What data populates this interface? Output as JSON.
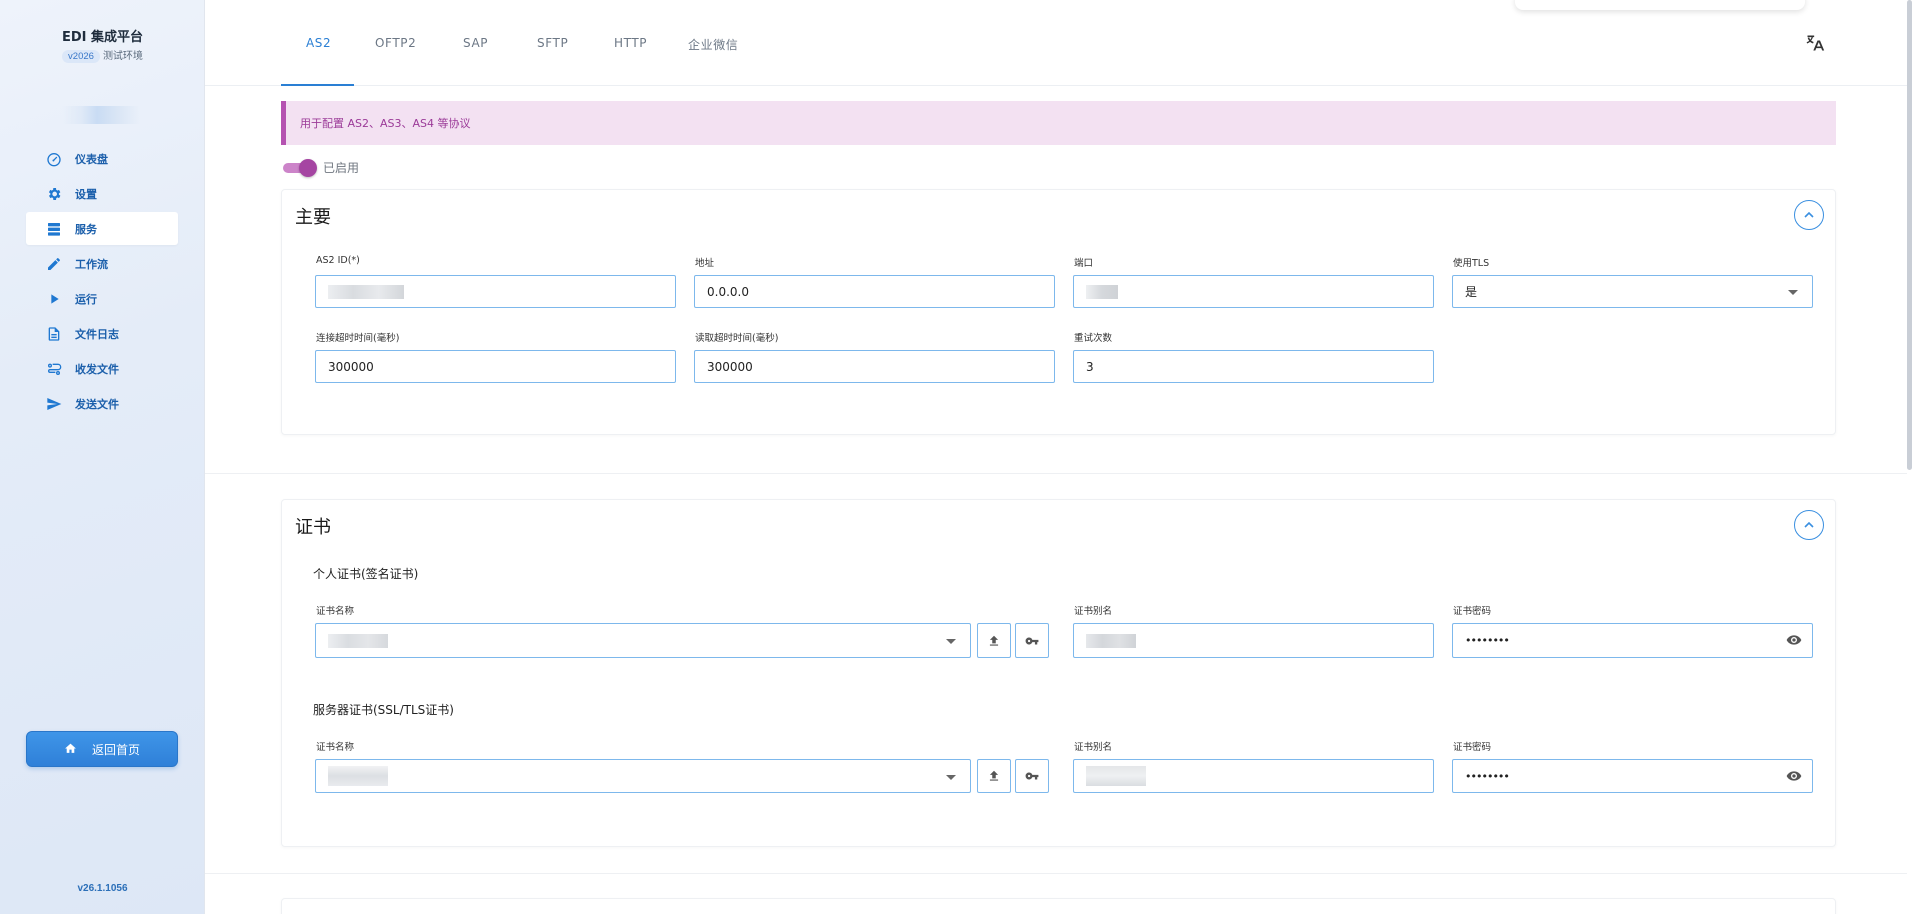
{
  "sidebar": {
    "brand_title": "EDI 集成平台",
    "env_badge": "v2026",
    "env_label": "测试环境",
    "nav_items": [
      {
        "label": "仪表盘",
        "icon": "dashboard-icon"
      },
      {
        "label": "设置",
        "icon": "gear-icon"
      },
      {
        "label": "服务",
        "icon": "server-icon",
        "active": true
      },
      {
        "label": "工作流",
        "icon": "pencil-icon"
      },
      {
        "label": "运行",
        "icon": "play-icon"
      },
      {
        "label": "文件日志",
        "icon": "file-log-icon"
      },
      {
        "label": "收发文件",
        "icon": "transfer-icon"
      },
      {
        "label": "发送文件",
        "icon": "send-icon"
      }
    ],
    "home_button": "返回首页",
    "version": "v26.1.1056"
  },
  "tabs": [
    "AS2",
    "OFTP2",
    "SAP",
    "SFTP",
    "HTTP",
    "企业微信"
  ],
  "active_tab": "AS2",
  "banner": "用于配置 AS2、AS3、AS4 等协议",
  "toggle": {
    "label": "已启用",
    "on": true
  },
  "main_section": {
    "title": "主要",
    "fields": {
      "as2_id": {
        "label": "AS2 ID(*)",
        "value": ""
      },
      "address": {
        "label": "地址",
        "value": "0.0.0.0"
      },
      "port": {
        "label": "端口",
        "value": ""
      },
      "use_tls": {
        "label": "使用TLS",
        "value": "是"
      },
      "connect_timeout": {
        "label": "连接超时时间(毫秒)",
        "value": "300000"
      },
      "read_timeout": {
        "label": "读取超时时间(毫秒)",
        "value": "300000"
      },
      "retry_count": {
        "label": "重试次数",
        "value": "3"
      }
    }
  },
  "cert_section": {
    "title": "证书",
    "personal": {
      "heading": "个人证书(签名证书)",
      "name_label": "证书名称",
      "alias_label": "证书别名",
      "password_label": "证书密码",
      "password_mask": "••••••••"
    },
    "server": {
      "heading": "服务器证书(SSL/TLS证书)",
      "name_label": "证书名称",
      "alias_label": "证书别名",
      "password_label": "证书密码",
      "password_mask": "••••••••"
    }
  },
  "colors": {
    "accent": "#2a7fd4",
    "banner_bg": "#f3e1f2",
    "banner_border": "#b552b1",
    "toggle": "#a545a2"
  }
}
